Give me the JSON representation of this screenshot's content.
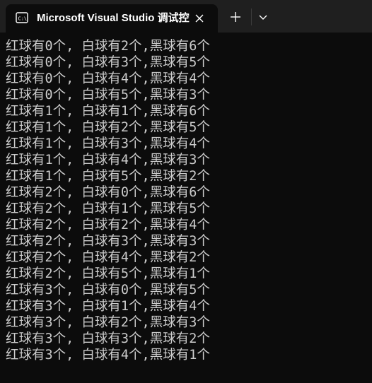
{
  "tab": {
    "title": "Microsoft Visual Studio 调试控",
    "icon": "terminal-icon"
  },
  "controls": {
    "close_icon": "close-icon",
    "new_tab_icon": "plus-icon",
    "dropdown_icon": "chevron-down-icon"
  },
  "colors": {
    "titlebar_bg": "#1f1f1f",
    "console_bg": "#0c0c0c",
    "console_text": "#cccccc"
  },
  "console": {
    "lines": [
      "红球有0个, 白球有2个,黑球有6个",
      "红球有0个, 白球有3个,黑球有5个",
      "红球有0个, 白球有4个,黑球有4个",
      "红球有0个, 白球有5个,黑球有3个",
      "红球有1个, 白球有1个,黑球有6个",
      "红球有1个, 白球有2个,黑球有5个",
      "红球有1个, 白球有3个,黑球有4个",
      "红球有1个, 白球有4个,黑球有3个",
      "红球有1个, 白球有5个,黑球有2个",
      "红球有2个, 白球有0个,黑球有6个",
      "红球有2个, 白球有1个,黑球有5个",
      "红球有2个, 白球有2个,黑球有4个",
      "红球有2个, 白球有3个,黑球有3个",
      "红球有2个, 白球有4个,黑球有2个",
      "红球有2个, 白球有5个,黑球有1个",
      "红球有3个, 白球有0个,黑球有5个",
      "红球有3个, 白球有1个,黑球有4个",
      "红球有3个, 白球有2个,黑球有3个",
      "红球有3个, 白球有3个,黑球有2个",
      "红球有3个, 白球有4个,黑球有1个"
    ]
  }
}
